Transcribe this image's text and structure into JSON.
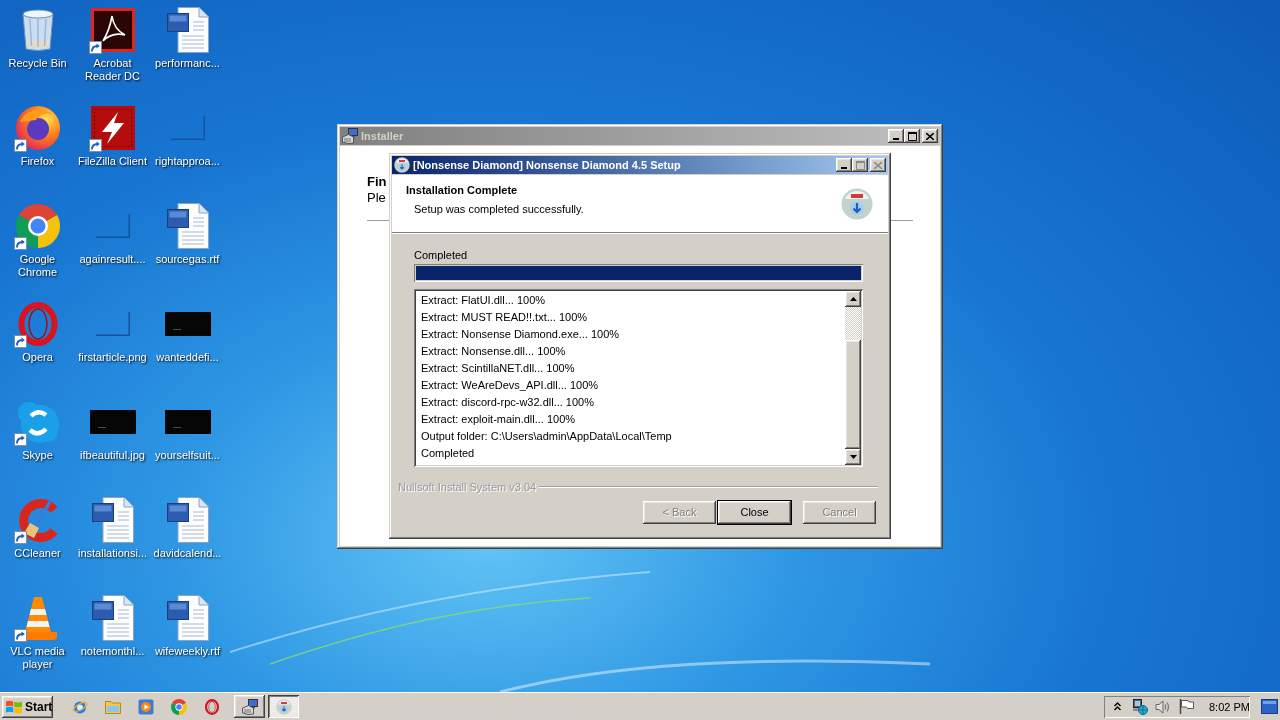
{
  "desktop": {
    "icons": [
      {
        "label": "Recycle Bin",
        "kind": "recycle-bin",
        "shortcut": false
      },
      {
        "label": "Acrobat Reader DC",
        "kind": "acrobat",
        "shortcut": true
      },
      {
        "label": "performanc...",
        "kind": "word-document",
        "shortcut": false
      },
      {
        "label": "Firefox",
        "kind": "firefox",
        "shortcut": true
      },
      {
        "label": "FileZilla Client",
        "kind": "filezilla",
        "shortcut": true
      },
      {
        "label": "rightapproa...",
        "kind": "blank-file",
        "shortcut": false
      },
      {
        "label": "Google Chrome",
        "kind": "chrome",
        "shortcut": true
      },
      {
        "label": "againresult....",
        "kind": "blank-file",
        "shortcut": false
      },
      {
        "label": "sourcegas.rtf",
        "kind": "word-document",
        "shortcut": false
      },
      {
        "label": "Opera",
        "kind": "opera",
        "shortcut": true
      },
      {
        "label": "firstarticle.png",
        "kind": "blank-file",
        "shortcut": false
      },
      {
        "label": "wanteddefi...",
        "kind": "dark-image",
        "shortcut": false
      },
      {
        "label": "Skype",
        "kind": "skype",
        "shortcut": true
      },
      {
        "label": "ifbeautiful.jpg",
        "kind": "dark-image",
        "shortcut": false
      },
      {
        "label": "yourselfsuit...",
        "kind": "dark-image",
        "shortcut": false
      },
      {
        "label": "CCleaner",
        "kind": "ccleaner",
        "shortcut": true
      },
      {
        "label": "installationsi...",
        "kind": "word-document",
        "shortcut": false
      },
      {
        "label": "davidcalend...",
        "kind": "word-document",
        "shortcut": false
      },
      {
        "label": "VLC media player",
        "kind": "vlc",
        "shortcut": true
      },
      {
        "label": "notemonthl...",
        "kind": "word-document",
        "shortcut": false
      },
      {
        "label": "wifeweekly.rtf",
        "kind": "word-document",
        "shortcut": false
      }
    ]
  },
  "installer_window": {
    "title": "Installer",
    "active": false,
    "title_buttons": [
      {
        "kind": "minimize",
        "disabled": false
      },
      {
        "kind": "maximize",
        "disabled": false
      },
      {
        "kind": "close",
        "disabled": false
      }
    ],
    "heading": "Fin",
    "subtitle": "Ple"
  },
  "setup_dialog": {
    "title": "[Nonsense Diamond] Nonsense Diamond 4.5 Setup",
    "active": true,
    "title_buttons": [
      {
        "kind": "minimize",
        "disabled": false
      },
      {
        "kind": "maximize",
        "disabled": true
      },
      {
        "kind": "close",
        "disabled": true
      }
    ],
    "header": {
      "title": "Installation Complete",
      "subtitle": "Setup was completed successfully."
    },
    "progress": {
      "label": "Completed",
      "level": 1
    },
    "log": [
      "Extract: FlatUI.dll... 100%",
      "Extract: MUST READ!!.txt... 100%",
      "Extract: Nonsense Diamond.exe... 100%",
      "Extract: Nonsense.dll... 100%",
      "Extract: ScintillaNET.dll... 100%",
      "Extract: WeAreDevs_API.dll... 100%",
      "Extract: discord-rpc-w32.dll... 100%",
      "Extract: exploit-main.dll... 100%",
      "Output folder: C:\\Users\\admin\\AppData\\Local\\Temp",
      "Completed"
    ],
    "branding": "Nullsoft Install System v3.04",
    "buttons": [
      {
        "label": "< Back",
        "disabled": true,
        "default": false
      },
      {
        "label": "Close",
        "disabled": false,
        "default": true
      },
      {
        "label": "Cancel",
        "disabled": true,
        "default": false
      }
    ]
  },
  "taskbar": {
    "start": "Start",
    "windows": [
      {
        "kind": "installer",
        "selected": false
      },
      {
        "kind": "setup",
        "selected": true
      }
    ],
    "clock": "8:02 PM"
  }
}
